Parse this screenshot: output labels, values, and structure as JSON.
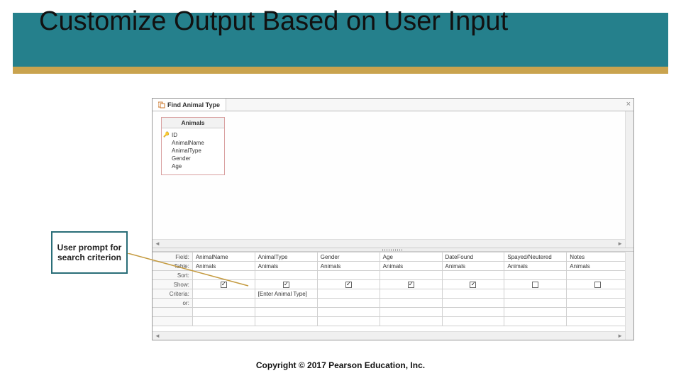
{
  "title": "Customize Output Based on User Input",
  "callout": "User prompt for search criterion",
  "tab": {
    "label": "Find Animal Type"
  },
  "tableBox": {
    "name": "Animals",
    "fields": [
      "ID",
      "AnimalName",
      "AnimalType",
      "Gender",
      "Age"
    ]
  },
  "gridRows": [
    "Field:",
    "Table:",
    "Sort:",
    "Show:",
    "Criteria:",
    "or:"
  ],
  "columns": [
    {
      "field": "AnimalName",
      "table": "Animals",
      "show": true,
      "criteria": ""
    },
    {
      "field": "AnimalType",
      "table": "Animals",
      "show": true,
      "criteria": "[Enter Animal Type]"
    },
    {
      "field": "Gender",
      "table": "Animals",
      "show": true,
      "criteria": ""
    },
    {
      "field": "Age",
      "table": "Animals",
      "show": true,
      "criteria": ""
    },
    {
      "field": "DateFound",
      "table": "Animals",
      "show": true,
      "criteria": ""
    },
    {
      "field": "Spayed/Neutered",
      "table": "Animals",
      "show": false,
      "criteria": ""
    },
    {
      "field": "Notes",
      "table": "Animals",
      "show": false,
      "criteria": ""
    }
  ],
  "copyright": "Copyright © 2017 Pearson Education, Inc."
}
